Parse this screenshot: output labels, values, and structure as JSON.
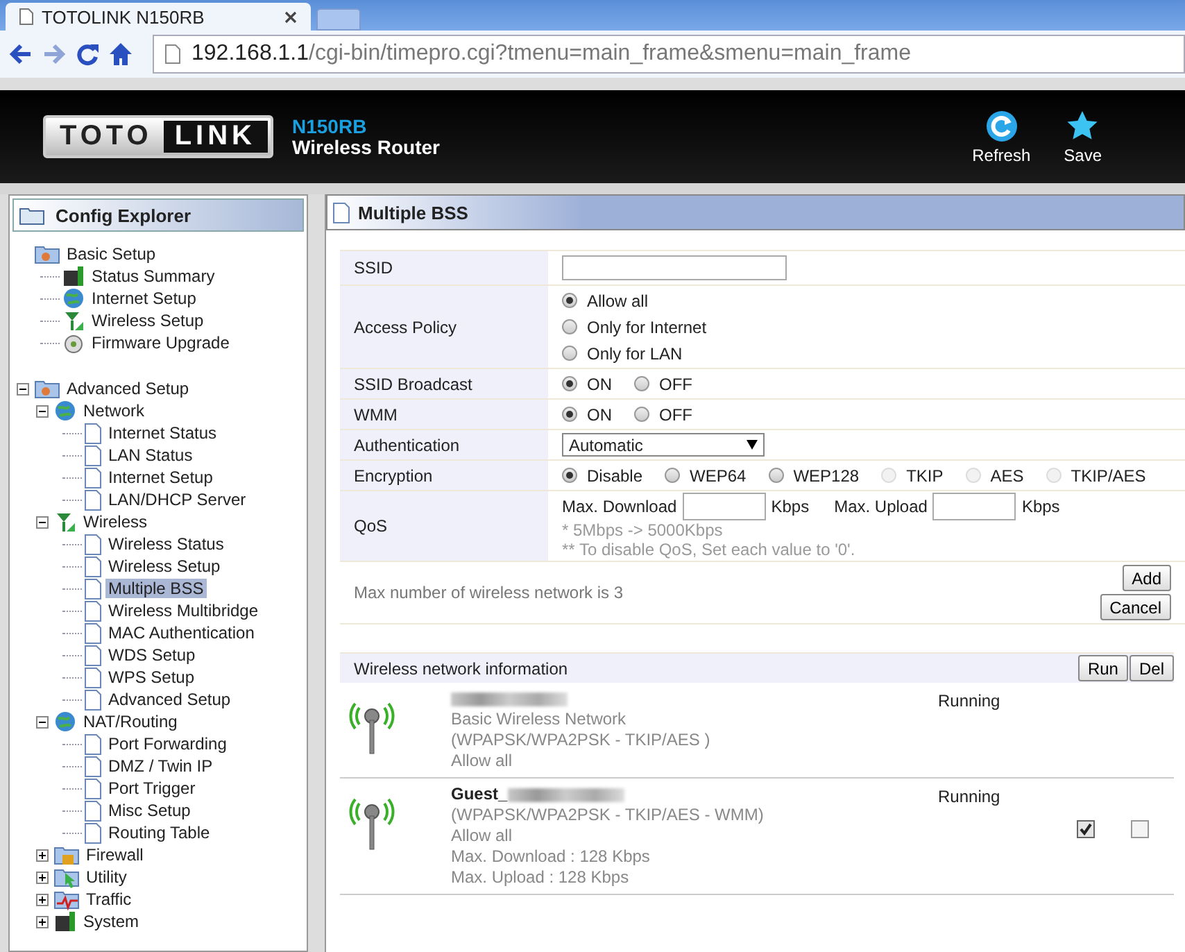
{
  "browser": {
    "tab_title": "TOTOLINK N150RB",
    "url_host": "192.168.1.1",
    "url_path": "/cgi-bin/timepro.cgi?tmenu=main_frame&smenu=main_frame"
  },
  "header": {
    "logo_left": "TOTO",
    "logo_right": "LINK",
    "model": "N150RB",
    "subtitle": "Wireless Router",
    "actions": [
      {
        "kind": "refresh",
        "label": "Refresh"
      },
      {
        "kind": "save",
        "label": "Save"
      }
    ]
  },
  "sidebar": {
    "title": "Config Explorer",
    "tree": [
      {
        "label": "Basic Setup",
        "kind": "group",
        "selected": false,
        "children": [
          {
            "label": "Status Summary",
            "kind": "status",
            "selected": false
          },
          {
            "label": "Internet Setup",
            "kind": "globe",
            "selected": false
          },
          {
            "label": "Wireless Setup",
            "kind": "antenna",
            "selected": false
          },
          {
            "label": "Firmware Upgrade",
            "kind": "disk",
            "selected": false
          }
        ]
      },
      {
        "label": "Advanced Setup",
        "kind": "group",
        "expanded": true,
        "selected": false,
        "children": [
          {
            "label": "Network",
            "kind": "globe",
            "expanded": true,
            "selected": false,
            "children": [
              {
                "label": "Internet Status",
                "kind": "page",
                "selected": false
              },
              {
                "label": "LAN Status",
                "kind": "page",
                "selected": false
              },
              {
                "label": "Internet Setup",
                "kind": "page",
                "selected": false
              },
              {
                "label": "LAN/DHCP Server",
                "kind": "page",
                "selected": false
              }
            ]
          },
          {
            "label": "Wireless",
            "kind": "antenna",
            "expanded": true,
            "selected": false,
            "children": [
              {
                "label": "Wireless Status",
                "kind": "page",
                "selected": false
              },
              {
                "label": "Wireless Setup",
                "kind": "page",
                "selected": false
              },
              {
                "label": "Multiple BSS",
                "kind": "page",
                "selected": true
              },
              {
                "label": "Wireless Multibridge",
                "kind": "page",
                "selected": false
              },
              {
                "label": "MAC Authentication",
                "kind": "page",
                "selected": false
              },
              {
                "label": "WDS Setup",
                "kind": "page",
                "selected": false
              },
              {
                "label": "WPS Setup",
                "kind": "page",
                "selected": false
              },
              {
                "label": "Advanced Setup",
                "kind": "page",
                "selected": false
              }
            ]
          },
          {
            "label": "NAT/Routing",
            "kind": "globe",
            "expanded": true,
            "selected": false,
            "children": [
              {
                "label": "Port Forwarding",
                "kind": "page",
                "selected": false
              },
              {
                "label": "DMZ / Twin IP",
                "kind": "page",
                "selected": false
              },
              {
                "label": "Port Trigger",
                "kind": "page",
                "selected": false
              },
              {
                "label": "Misc Setup",
                "kind": "page",
                "selected": false
              },
              {
                "label": "Routing Table",
                "kind": "page",
                "selected": false
              }
            ]
          },
          {
            "label": "Firewall",
            "kind": "lock",
            "expanded": false,
            "selected": false
          },
          {
            "label": "Utility",
            "kind": "cursor",
            "expanded": false,
            "selected": false
          },
          {
            "label": "Traffic",
            "kind": "pulse",
            "expanded": false,
            "selected": false
          },
          {
            "label": "System",
            "kind": "status",
            "expanded": false,
            "selected": false
          }
        ]
      }
    ]
  },
  "panel": {
    "title": "Multiple BSS",
    "form": [
      {
        "kind": "text",
        "label": "SSID"
      },
      {
        "kind": "radio-list",
        "label": "Access Policy",
        "options": [
          {
            "label": "Allow all",
            "selected": true,
            "disabled": false
          },
          {
            "label": "Only for Internet",
            "selected": false,
            "disabled": false
          },
          {
            "label": "Only for LAN",
            "selected": false,
            "disabled": false
          }
        ]
      },
      {
        "kind": "radio",
        "label": "SSID Broadcast",
        "options": [
          {
            "label": "ON",
            "selected": true,
            "disabled": false
          },
          {
            "label": "OFF",
            "selected": false,
            "disabled": false
          }
        ]
      },
      {
        "kind": "radio",
        "label": "WMM",
        "options": [
          {
            "label": "ON",
            "selected": true,
            "disabled": false
          },
          {
            "label": "OFF",
            "selected": false,
            "disabled": false
          }
        ]
      },
      {
        "kind": "select",
        "label": "Authentication",
        "value": "Automatic"
      },
      {
        "kind": "radio",
        "label": "Encryption",
        "options": [
          {
            "label": "Disable",
            "selected": true,
            "disabled": false
          },
          {
            "label": "WEP64",
            "selected": false,
            "disabled": false
          },
          {
            "label": "WEP128",
            "selected": false,
            "disabled": false
          },
          {
            "label": "TKIP",
            "selected": false,
            "disabled": true
          },
          {
            "label": "AES",
            "selected": false,
            "disabled": true
          },
          {
            "label": "TKIP/AES",
            "selected": false,
            "disabled": true
          }
        ]
      },
      {
        "kind": "qos",
        "label": "QoS",
        "download_label": "Max. Download",
        "download_unit": "Kbps",
        "upload_label": "Max. Upload",
        "upload_unit": "Kbps",
        "notes": [
          "* 5Mbps -> 5000Kbps",
          "** To disable QoS, Set each value to '0'."
        ]
      }
    ],
    "max_note": "Max number of wireless network is 3",
    "form_buttons": [
      "Add",
      "Cancel"
    ],
    "networks_title": "Wireless network information",
    "network_buttons": [
      "Run",
      "Del"
    ],
    "networks": [
      {
        "name_redacted": true,
        "lines": [
          "Basic Wireless Network",
          "(WPAPSK/WPA2PSK - TKIP/AES )",
          "Allow all"
        ],
        "status": "Running"
      },
      {
        "name": "Guest_",
        "name_redacted": true,
        "lines": [
          "(WPAPSK/WPA2PSK - TKIP/AES - WMM)",
          "Allow all",
          "Max. Download : 128 Kbps",
          "Max. Upload : 128 Kbps"
        ],
        "status": "Running",
        "run_checked": true,
        "del_checked": false
      }
    ]
  }
}
